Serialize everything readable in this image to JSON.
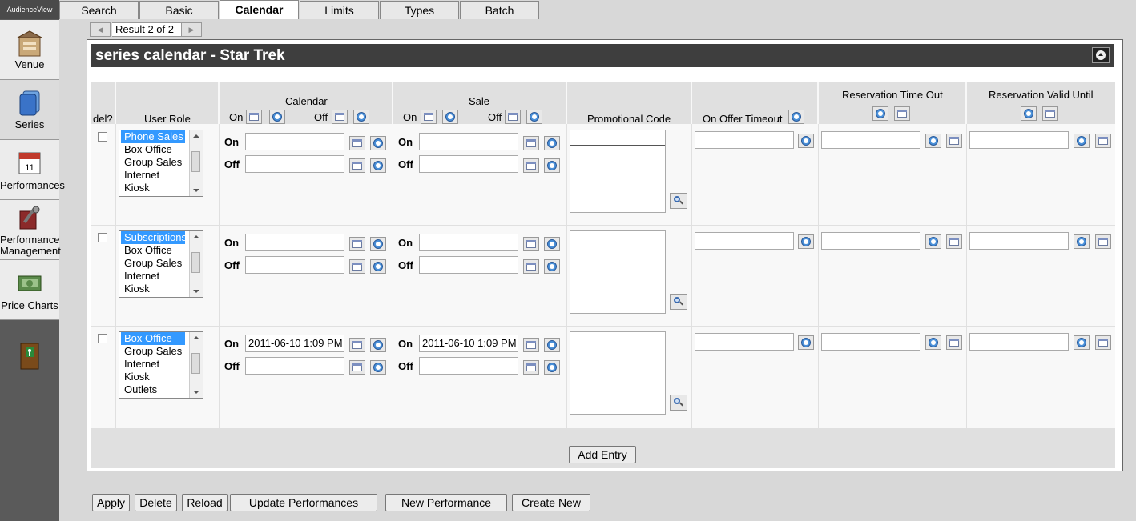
{
  "app": {
    "brand": "AudienceView"
  },
  "sidebar": {
    "items": [
      {
        "label": "Venue",
        "icon": "venue-icon"
      },
      {
        "label": "Series",
        "icon": "series-icon"
      },
      {
        "label": "Performances",
        "icon": "performances-icon"
      },
      {
        "label": "Performance Management",
        "icon": "performance-management-icon"
      },
      {
        "label": "Price Charts",
        "icon": "price-charts-icon"
      },
      {
        "label": "",
        "icon": "exit-door-icon"
      }
    ]
  },
  "tabs": [
    {
      "label": "Search"
    },
    {
      "label": "Basic"
    },
    {
      "label": "Calendar",
      "active": true
    },
    {
      "label": "Limits"
    },
    {
      "label": "Types"
    },
    {
      "label": "Batch"
    }
  ],
  "pager": {
    "label": "Result 2 of 2"
  },
  "panel": {
    "title": "series calendar - Star Trek"
  },
  "columns": {
    "del": "del?",
    "user_role": "User Role",
    "calendar": "Calendar",
    "sale": "Sale",
    "on": "On",
    "off": "Off",
    "promo": "Promotional Code",
    "offer_timeout": "On Offer Timeout",
    "res_timeout": "Reservation Time Out",
    "res_valid": "Reservation Valid Until"
  },
  "rows": [
    {
      "roles": [
        "Phone Sales",
        "Box Office",
        "Group Sales",
        "Internet",
        "Kiosk"
      ],
      "selected": 0,
      "calendar_on": "",
      "calendar_off": "",
      "sale_on": "",
      "sale_off": ""
    },
    {
      "roles": [
        "Subscriptions",
        "Box Office",
        "Group Sales",
        "Internet",
        "Kiosk"
      ],
      "selected": 0,
      "calendar_on": "",
      "calendar_off": "",
      "sale_on": "",
      "sale_off": ""
    },
    {
      "roles": [
        "Box Office",
        "Group Sales",
        "Internet",
        "Kiosk",
        "Outlets"
      ],
      "selected": 0,
      "calendar_on": "2011-06-10 1:09 PM",
      "calendar_off": "",
      "sale_on": "2011-06-10 1:09 PM",
      "sale_off": ""
    }
  ],
  "add_entry_label": "Add Entry",
  "actions": {
    "apply": "Apply",
    "delete": "Delete",
    "reload": "Reload",
    "update": "Update Performances",
    "new_performance": "New Performance",
    "create_new": "Create New"
  }
}
